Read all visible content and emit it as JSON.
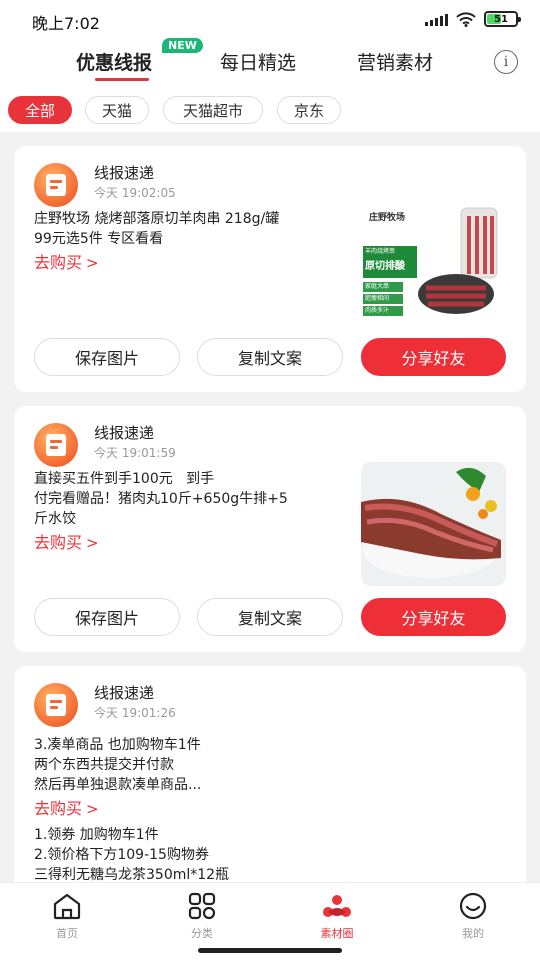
{
  "status": {
    "time": "晚上7:02",
    "battery": "51"
  },
  "top_tabs": [
    {
      "label": "优惠线报",
      "active": true,
      "badge": "NEW"
    },
    {
      "label": "每日精选",
      "active": false
    },
    {
      "label": "营销素材",
      "active": false
    }
  ],
  "filters": [
    "全部",
    "天猫",
    "天猫超市",
    "京东"
  ],
  "cards": [
    {
      "sender": "线报速递",
      "time": "今天 19:02:05",
      "text": "庄野牧场 烧烤部落原切羊肉串 218g/罐\n99元选5件 专区看看",
      "buy_label": "去购买",
      "product_caption": "庄野牧场",
      "product_tags": [
        "羊肉烧烤串",
        "原切排酸",
        "家庭大串",
        "肥瘦相间",
        "肉质多汁"
      ],
      "buttons": {
        "save": "保存图片",
        "copy": "复制文案",
        "share": "分享好友"
      }
    },
    {
      "sender": "线报速递",
      "time": "今天 19:01:59",
      "text": "直接买五件到手100元   到手\n付完看赠品！猪肉丸10斤+650g牛排+5\n斤水饺",
      "buy_label": "去购买",
      "buttons": {
        "save": "保存图片",
        "copy": "复制文案",
        "share": "分享好友"
      }
    },
    {
      "sender": "线报速递",
      "time": "今天 19:01:26",
      "text": "3.凑单商品 也加购物车1件\n两个东西共提交并付款\n然后再单独退款凑单商品...",
      "buy_label": "去购买",
      "extra_text": "1.领券 加购物车1件\n2.领价格下方109-15购物券\n三得利无糖乌龙茶350ml*12瓶"
    }
  ],
  "tabbar": [
    {
      "label": "首页",
      "icon": "home-icon",
      "active": false
    },
    {
      "label": "分类",
      "icon": "category-icon",
      "active": false
    },
    {
      "label": "素材圈",
      "icon": "material-circle-icon",
      "active": true
    },
    {
      "label": "我的",
      "icon": "profile-icon",
      "active": false
    }
  ],
  "colors": {
    "accent": "#e8333b",
    "badge_green": "#19b876"
  }
}
